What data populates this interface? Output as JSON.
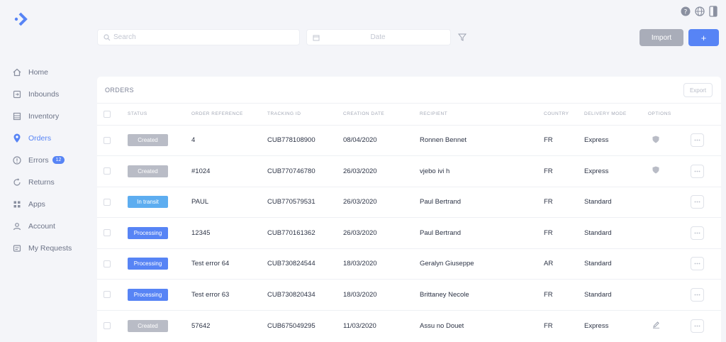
{
  "brand": {
    "logo_icon": "arrow-logo-icon",
    "accent": "#5784f5"
  },
  "header": {
    "icons": [
      "help-icon",
      "globe-icon",
      "panel-icon"
    ],
    "search_placeholder": "Search",
    "date_placeholder": "Date",
    "import_label": "Import",
    "add_label": "+"
  },
  "sidebar": {
    "items": [
      {
        "label": "Home",
        "icon": "home-icon"
      },
      {
        "label": "Inbounds",
        "icon": "inbounds-icon"
      },
      {
        "label": "Inventory",
        "icon": "inventory-icon"
      },
      {
        "label": "Orders",
        "icon": "location-pin-icon",
        "active": true
      },
      {
        "label": "Errors",
        "icon": "error-icon",
        "badge": "12"
      },
      {
        "label": "Returns",
        "icon": "returns-icon"
      },
      {
        "label": "Apps",
        "icon": "apps-grid-icon"
      },
      {
        "label": "Account",
        "icon": "user-icon"
      },
      {
        "label": "My Requests",
        "icon": "requests-icon"
      }
    ]
  },
  "orders": {
    "title": "ORDERS",
    "export_label": "Export",
    "columns": [
      "STATUS",
      "ORDER REFERENCE",
      "TRACKING ID",
      "CREATION DATE",
      "RECIPIENT",
      "COUNTRY",
      "DELIVERY MODE",
      "OPTIONS"
    ],
    "rows": [
      {
        "status": "Created",
        "status_kind": "created",
        "reference": "4",
        "tracking": "CUB778108900",
        "date": "08/04/2020",
        "recipient": "Ronnen Bennet",
        "country": "FR",
        "mode": "Express",
        "option_icon": "shield-icon"
      },
      {
        "status": "Created",
        "status_kind": "created",
        "reference": "#1024",
        "tracking": "CUB770746780",
        "date": "26/03/2020",
        "recipient": "vjebo ivi h",
        "country": "FR",
        "mode": "Express",
        "option_icon": "shield-icon"
      },
      {
        "status": "In transit",
        "status_kind": "transit",
        "reference": "PAUL",
        "tracking": "CUB770579531",
        "date": "26/03/2020",
        "recipient": "Paul Bertrand",
        "country": "FR",
        "mode": "Standard",
        "option_icon": ""
      },
      {
        "status": "Processing",
        "status_kind": "processing",
        "reference": "12345",
        "tracking": "CUB770161362",
        "date": "26/03/2020",
        "recipient": "Paul Bertrand",
        "country": "FR",
        "mode": "Standard",
        "option_icon": ""
      },
      {
        "status": "Processing",
        "status_kind": "processing",
        "reference": "Test error 64",
        "tracking": "CUB730824544",
        "date": "18/03/2020",
        "recipient": "Geralyn Giuseppe",
        "country": "AR",
        "mode": "Standard",
        "option_icon": ""
      },
      {
        "status": "Processing",
        "status_kind": "processing",
        "reference": "Test error 63",
        "tracking": "CUB730820434",
        "date": "18/03/2020",
        "recipient": "Brittaney Necole",
        "country": "FR",
        "mode": "Standard",
        "option_icon": ""
      },
      {
        "status": "Created",
        "status_kind": "created",
        "reference": "57642",
        "tracking": "CUB675049295",
        "date": "11/03/2020",
        "recipient": "Assu no Douet",
        "country": "FR",
        "mode": "Express",
        "option_icon": "pencil-icon"
      }
    ]
  },
  "colors": {
    "created": "#b9bcc6",
    "in_transit": "#5dadf0",
    "processing": "#5784f5",
    "import_button": "#a9adb9"
  }
}
